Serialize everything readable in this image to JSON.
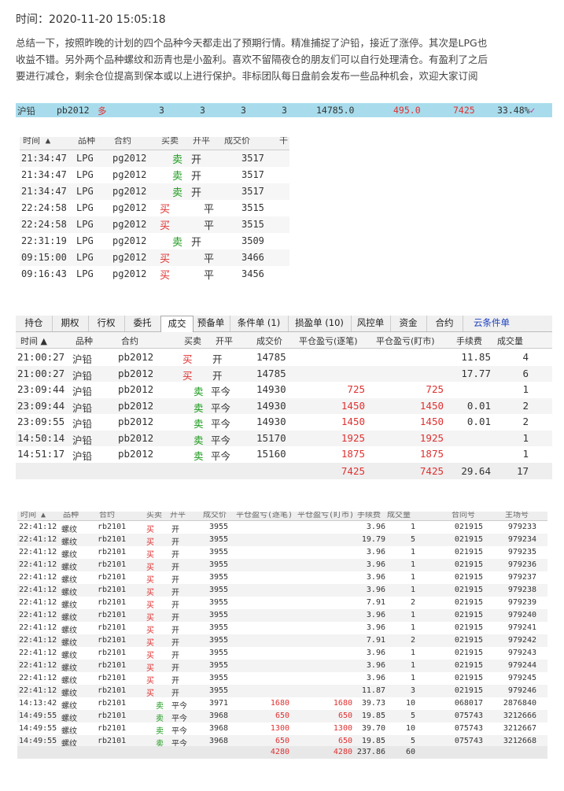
{
  "header": {
    "time_label": "时间：",
    "time_value": "2020-11-20 15:05:18"
  },
  "intro_lines": [
    "总结一下，按照昨晚的计划的四个品种今天都走出了预期行情。精准捕捉了沪铅，接近了涨停。其次是LPG也",
    "收益不错。另外两个品种螺纹和沥青也是小盈利。喜欢不留隔夜仓的朋友们可以自行处理清仓。有盈利了之后",
    "要进行减仓，剩余仓位提高到保本或以上进行保护。非标团队每日盘前会发布一些品种机会，欢迎大家订阅"
  ],
  "summary": {
    "name": "沪铅",
    "contract": "pb2012",
    "direction": "多",
    "q1": "3",
    "q2": "3",
    "q3": "3",
    "q4": "3",
    "price": "14785.0",
    "pnl1": "495.0",
    "pnl2": "7425",
    "ratio": "33.48%"
  },
  "panel1": {
    "headers": [
      "时间 ▲",
      "品种",
      "合约",
      "买卖",
      "开平",
      "成交价",
      "干"
    ],
    "rows": [
      {
        "time": "21:34:47",
        "product": "LPG",
        "contract": "pg2012",
        "side": "卖",
        "oc": "开",
        "price": "3517"
      },
      {
        "time": "21:34:47",
        "product": "LPG",
        "contract": "pg2012",
        "side": "卖",
        "oc": "开",
        "price": "3517"
      },
      {
        "time": "21:34:47",
        "product": "LPG",
        "contract": "pg2012",
        "side": "卖",
        "oc": "开",
        "price": "3517"
      },
      {
        "time": "22:24:58",
        "product": "LPG",
        "contract": "pg2012",
        "side": "买",
        "oc": "平",
        "price": "3515"
      },
      {
        "time": "22:24:58",
        "product": "LPG",
        "contract": "pg2012",
        "side": "买",
        "oc": "平",
        "price": "3515"
      },
      {
        "time": "22:31:19",
        "product": "LPG",
        "contract": "pg2012",
        "side": "卖",
        "oc": "开",
        "price": "3509"
      },
      {
        "time": "09:15:00",
        "product": "LPG",
        "contract": "pg2012",
        "side": "买",
        "oc": "平",
        "price": "3466"
      },
      {
        "time": "09:16:43",
        "product": "LPG",
        "contract": "pg2012",
        "side": "买",
        "oc": "平",
        "price": "3456"
      }
    ]
  },
  "panel2": {
    "tabs": [
      "持仓",
      "期权",
      "行权",
      "委托",
      "成交",
      "预备单",
      "条件单 (1)",
      "损盈单 (10)",
      "风控单",
      "资金",
      "合约",
      "云条件单"
    ],
    "active_tab": "成交",
    "headers": [
      "时间 ▲",
      "品种",
      "合约",
      "买卖",
      "开平",
      "成交价",
      "平仓盈亏(逐笔)",
      "平仓盈亏(盯市)",
      "手续费",
      "成交量"
    ],
    "rows": [
      {
        "time": "21:00:27",
        "product": "沪铅",
        "contract": "pb2012",
        "side": "买",
        "oc": "开",
        "price": "14785",
        "pnl_a": "",
        "pnl_b": "",
        "fee": "11.85",
        "vol": "4"
      },
      {
        "time": "21:00:27",
        "product": "沪铅",
        "contract": "pb2012",
        "side": "买",
        "oc": "开",
        "price": "14785",
        "pnl_a": "",
        "pnl_b": "",
        "fee": "17.77",
        "vol": "6"
      },
      {
        "time": "23:09:44",
        "product": "沪铅",
        "contract": "pb2012",
        "side": "卖",
        "oc": "平今",
        "price": "14930",
        "pnl_a": "725",
        "pnl_b": "725",
        "fee": "",
        "vol": "1"
      },
      {
        "time": "23:09:44",
        "product": "沪铅",
        "contract": "pb2012",
        "side": "卖",
        "oc": "平今",
        "price": "14930",
        "pnl_a": "1450",
        "pnl_b": "1450",
        "fee": "0.01",
        "vol": "2"
      },
      {
        "time": "23:09:55",
        "product": "沪铅",
        "contract": "pb2012",
        "side": "卖",
        "oc": "平今",
        "price": "14930",
        "pnl_a": "1450",
        "pnl_b": "1450",
        "fee": "0.01",
        "vol": "2"
      },
      {
        "time": "14:50:14",
        "product": "沪铅",
        "contract": "pb2012",
        "side": "卖",
        "oc": "平今",
        "price": "15170",
        "pnl_a": "1925",
        "pnl_b": "1925",
        "fee": "",
        "vol": "1"
      },
      {
        "time": "14:51:17",
        "product": "沪铅",
        "contract": "pb2012",
        "side": "卖",
        "oc": "平今",
        "price": "15160",
        "pnl_a": "1875",
        "pnl_b": "1875",
        "fee": "",
        "vol": "1"
      }
    ],
    "totals": {
      "pnl_a": "7425",
      "pnl_b": "7425",
      "fee": "29.64",
      "vol": "17"
    }
  },
  "panel3": {
    "headers": [
      "时间 ▲",
      "品种",
      "合约",
      "买卖",
      "开平",
      "成交价",
      "平仓盈亏(逐笔)",
      "平仓盈亏(盯市)",
      "手续费",
      "成交量",
      "合同号",
      "主场号"
    ],
    "rows": [
      {
        "time": "22:41:12",
        "product": "螺纹",
        "contract": "rb2101",
        "side": "买",
        "oc": "开",
        "price": "3955",
        "pa": "",
        "pb": "",
        "fee": "3.96",
        "vol": "1",
        "c1": "021915",
        "c2": "979233"
      },
      {
        "time": "22:41:12",
        "product": "螺纹",
        "contract": "rb2101",
        "side": "买",
        "oc": "开",
        "price": "3955",
        "pa": "",
        "pb": "",
        "fee": "19.79",
        "vol": "5",
        "c1": "021915",
        "c2": "979234"
      },
      {
        "time": "22:41:12",
        "product": "螺纹",
        "contract": "rb2101",
        "side": "买",
        "oc": "开",
        "price": "3955",
        "pa": "",
        "pb": "",
        "fee": "3.96",
        "vol": "1",
        "c1": "021915",
        "c2": "979235"
      },
      {
        "time": "22:41:12",
        "product": "螺纹",
        "contract": "rb2101",
        "side": "买",
        "oc": "开",
        "price": "3955",
        "pa": "",
        "pb": "",
        "fee": "3.96",
        "vol": "1",
        "c1": "021915",
        "c2": "979236"
      },
      {
        "time": "22:41:12",
        "product": "螺纹",
        "contract": "rb2101",
        "side": "买",
        "oc": "开",
        "price": "3955",
        "pa": "",
        "pb": "",
        "fee": "3.96",
        "vol": "1",
        "c1": "021915",
        "c2": "979237"
      },
      {
        "time": "22:41:12",
        "product": "螺纹",
        "contract": "rb2101",
        "side": "买",
        "oc": "开",
        "price": "3955",
        "pa": "",
        "pb": "",
        "fee": "3.96",
        "vol": "1",
        "c1": "021915",
        "c2": "979238"
      },
      {
        "time": "22:41:12",
        "product": "螺纹",
        "contract": "rb2101",
        "side": "买",
        "oc": "开",
        "price": "3955",
        "pa": "",
        "pb": "",
        "fee": "7.91",
        "vol": "2",
        "c1": "021915",
        "c2": "979239"
      },
      {
        "time": "22:41:12",
        "product": "螺纹",
        "contract": "rb2101",
        "side": "买",
        "oc": "开",
        "price": "3955",
        "pa": "",
        "pb": "",
        "fee": "3.96",
        "vol": "1",
        "c1": "021915",
        "c2": "979240"
      },
      {
        "time": "22:41:12",
        "product": "螺纹",
        "contract": "rb2101",
        "side": "买",
        "oc": "开",
        "price": "3955",
        "pa": "",
        "pb": "",
        "fee": "3.96",
        "vol": "1",
        "c1": "021915",
        "c2": "979241"
      },
      {
        "time": "22:41:12",
        "product": "螺纹",
        "contract": "rb2101",
        "side": "买",
        "oc": "开",
        "price": "3955",
        "pa": "",
        "pb": "",
        "fee": "7.91",
        "vol": "2",
        "c1": "021915",
        "c2": "979242"
      },
      {
        "time": "22:41:12",
        "product": "螺纹",
        "contract": "rb2101",
        "side": "买",
        "oc": "开",
        "price": "3955",
        "pa": "",
        "pb": "",
        "fee": "3.96",
        "vol": "1",
        "c1": "021915",
        "c2": "979243"
      },
      {
        "time": "22:41:12",
        "product": "螺纹",
        "contract": "rb2101",
        "side": "买",
        "oc": "开",
        "price": "3955",
        "pa": "",
        "pb": "",
        "fee": "3.96",
        "vol": "1",
        "c1": "021915",
        "c2": "979244"
      },
      {
        "time": "22:41:12",
        "product": "螺纹",
        "contract": "rb2101",
        "side": "买",
        "oc": "开",
        "price": "3955",
        "pa": "",
        "pb": "",
        "fee": "3.96",
        "vol": "1",
        "c1": "021915",
        "c2": "979245"
      },
      {
        "time": "22:41:12",
        "product": "螺纹",
        "contract": "rb2101",
        "side": "买",
        "oc": "开",
        "price": "3955",
        "pa": "",
        "pb": "",
        "fee": "11.87",
        "vol": "3",
        "c1": "021915",
        "c2": "979246"
      },
      {
        "time": "14:13:42",
        "product": "螺纹",
        "contract": "rb2101",
        "side": "卖",
        "oc": "平今",
        "price": "3971",
        "pa": "1680",
        "pb": "1680",
        "fee": "39.73",
        "vol": "10",
        "c1": "068017",
        "c2": "2876840"
      },
      {
        "time": "14:49:55",
        "product": "螺纹",
        "contract": "rb2101",
        "side": "卖",
        "oc": "平今",
        "price": "3968",
        "pa": "650",
        "pb": "650",
        "fee": "19.85",
        "vol": "5",
        "c1": "075743",
        "c2": "3212666"
      },
      {
        "time": "14:49:55",
        "product": "螺纹",
        "contract": "rb2101",
        "side": "卖",
        "oc": "平今",
        "price": "3968",
        "pa": "1300",
        "pb": "1300",
        "fee": "39.70",
        "vol": "10",
        "c1": "075743",
        "c2": "3212667"
      },
      {
        "time": "14:49:55",
        "product": "螺纹",
        "contract": "rb2101",
        "side": "卖",
        "oc": "平今",
        "price": "3968",
        "pa": "650",
        "pb": "650",
        "fee": "19.85",
        "vol": "5",
        "c1": "075743",
        "c2": "3212668"
      }
    ],
    "totals": {
      "pa": "4280",
      "pb": "4280",
      "fee": "237.86",
      "vol": "60"
    }
  },
  "colors": {
    "buy": "#e03030",
    "sell": "#1a9a1a",
    "summary_bg": "#a8dcec",
    "cloud_tab": "#1a3fbf"
  }
}
